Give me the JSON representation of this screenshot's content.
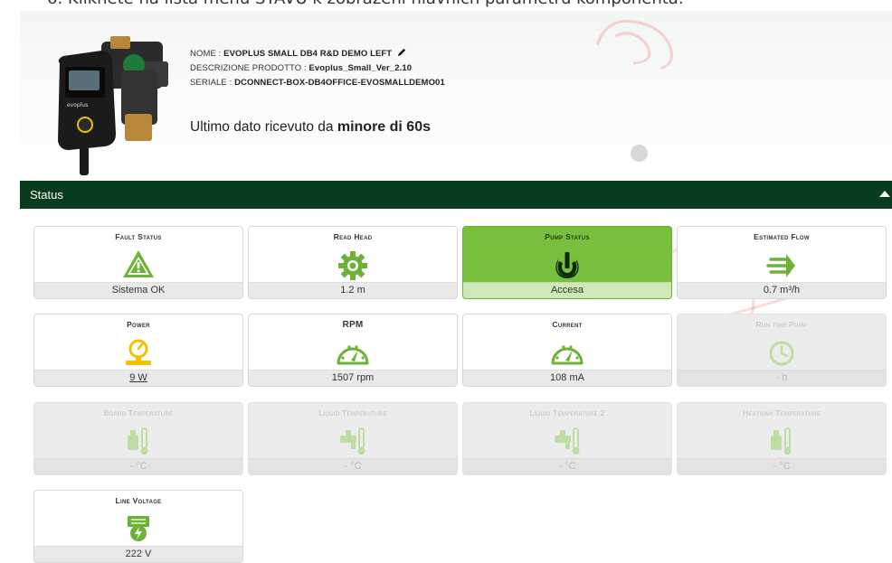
{
  "top_instruction": "6.  Kliknete na lista menu STAVU k zobrazeni hlavnich parametru komponenta.",
  "device": {
    "name_label": "NOME :",
    "name_value": "EVOPLUS SMALL DB4 R&D DEMO LEFT",
    "description_label": "DESCRIZIONE PRODOTTO :",
    "description_value": "Evoplus_Small_Ver_2.10",
    "serial_label": "SERIALE :",
    "serial_value": "DCONNECT-BOX-DB4OFFICE-EVOSMALLDEMO01",
    "last_data_prefix": "Ultimo dato ricevuto da",
    "last_data_value": "minore di 60s"
  },
  "section": {
    "title": "Status"
  },
  "cards": [
    {
      "title": "Fault Status",
      "value": "Sistema OK",
      "icon": "warning-triangle-icon",
      "state": "normal"
    },
    {
      "title": "Read Head",
      "value": "1.2 m",
      "icon": "gear-icon",
      "state": "normal"
    },
    {
      "title": "Pump Status",
      "value": "Accesa",
      "icon": "power-icon",
      "state": "active"
    },
    {
      "title": "Estimated Flow",
      "value": "0.7 m³/h",
      "icon": "flow-arrows-icon",
      "state": "normal"
    },
    {
      "title": "Power",
      "value": "9 W",
      "icon": "power-meter-icon",
      "state": "normal"
    },
    {
      "title": "RPM",
      "value": "1507 rpm",
      "icon": "gauge-icon",
      "state": "normal"
    },
    {
      "title": "Current",
      "value": "108 mA",
      "icon": "gauge-icon",
      "state": "normal"
    },
    {
      "title": "Run time Pump",
      "value": "- h",
      "icon": "clock-icon",
      "state": "disabled"
    },
    {
      "title": "Board Temperature",
      "value": "- °C",
      "icon": "board-thermometer-icon",
      "state": "disabled"
    },
    {
      "title": "Liquid Temperature",
      "value": "- °C",
      "icon": "tap-thermometer-icon",
      "state": "disabled"
    },
    {
      "title": "Liquid Temperature 2",
      "value": "- °C",
      "icon": "tap-thermometer-icon",
      "state": "disabled"
    },
    {
      "title": "Heatsink Temperature",
      "value": "- °C",
      "icon": "board-thermometer-icon",
      "state": "disabled"
    },
    {
      "title": "Line Voltage",
      "value": "222 V",
      "icon": "battery-bolt-icon",
      "state": "normal"
    }
  ],
  "colors": {
    "header_bar": "#073d1d",
    "active_card": "#77bf3d",
    "icon_green": "#6cb236",
    "icon_yellow": "#f2c200",
    "watermark": "#ee2222"
  }
}
